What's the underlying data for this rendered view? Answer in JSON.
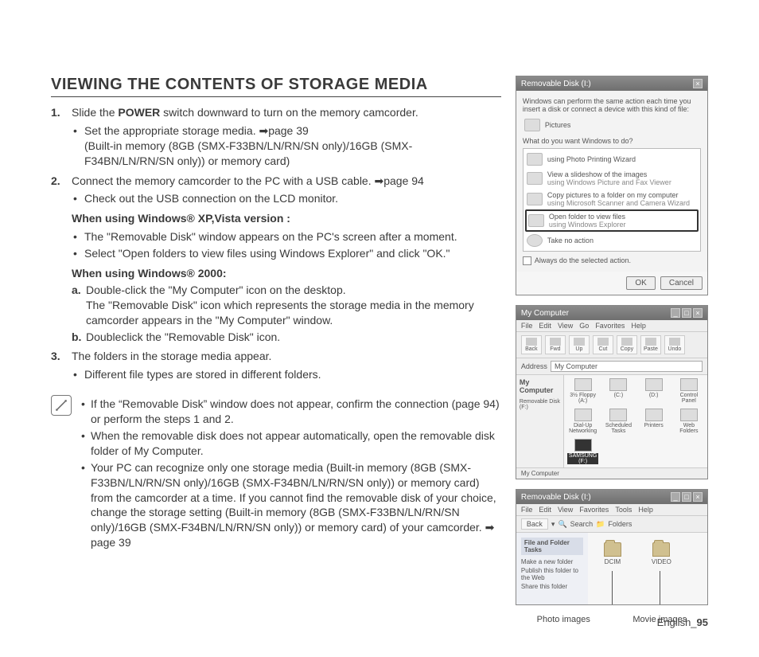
{
  "title": "VIEWING THE CONTENTS OF STORAGE MEDIA",
  "step1": {
    "text_a": "Slide the ",
    "bold": "POWER",
    "text_b": " switch downward to turn on the memory camcorder.",
    "b1": "Set the appropriate storage media. ",
    "b1_ref": "page 39",
    "b1_detail": "(Built-in memory (8GB (SMX-F33BN/LN/RN/SN only)/16GB (SMX-F34BN/LN/RN/SN only)) or memory card)"
  },
  "step2": {
    "text": "Connect the memory camcorder to the PC with a USB cable. ",
    "ref": "page 94",
    "b1": "Check out the USB connection on the LCD monitor.",
    "xp_head": "When using Windows® XP,Vista version :",
    "xp_b1": "The \"Removable Disk\" window appears on the PC's screen after a moment.",
    "xp_b2": "Select \"Open folders to view files using Windows Explorer\" and click \"OK.\"",
    "w2k_head": "When using Windows® 2000:",
    "a_text": "Double-click the \"My Computer\" icon on the desktop.\nThe \"Removable Disk\" icon which represents the storage media in the memory camcorder appears in the \"My Computer\" window.",
    "b_text": "Doubleclick the \"Removable Disk\" icon."
  },
  "step3": {
    "text": "The folders in the storage media appear.",
    "b1": "Different file types are stored in different folders."
  },
  "note": {
    "b1": "If the “Removable Disk” window does not appear, confirm the connection (page 94) or perform the steps 1 and 2.",
    "b2": "When the removable disk does not appear automatically, open the removable disk folder of My Computer.",
    "b3": "Your PC can recognize only one storage media (Built-in memory (8GB (SMX-F33BN/LN/RN/SN only)/16GB (SMX-F34BN/LN/RN/SN only)) or memory card) from the camcorder at a time. If you cannot find the removable disk of your choice, change the storage setting (Built-in memory (8GB (SMX-F33BN/LN/RN/SN only)/16GB (SMX-F34BN/LN/RN/SN only)) or memory card) of your camcorder. ",
    "b3_ref": "page 39"
  },
  "dialog1": {
    "title": "Removable Disk (I:)",
    "intro": "Windows can perform the same action each time you insert a disk or connect a device with this kind of file:",
    "type": "Pictures",
    "prompt": "What do you want Windows to do?",
    "opt1": "using Photo Printing Wizard",
    "opt2a": "View a slideshow of the images",
    "opt2b": "using Windows Picture and Fax Viewer",
    "opt3a": "Copy pictures to a folder on my computer",
    "opt3b": "using Microsoft Scanner and Camera Wizard",
    "opt4a": "Open folder to view files",
    "opt4b": "using Windows Explorer",
    "opt5": "Take no action",
    "always": "Always do the selected action.",
    "ok": "OK",
    "cancel": "Cancel"
  },
  "dialog2": {
    "title": "My Computer",
    "menu": [
      "File",
      "Edit",
      "View",
      "Go",
      "Favorites",
      "Help"
    ],
    "tools": [
      "Back",
      "Fwd",
      "Up",
      "Cut",
      "Copy",
      "Paste",
      "Undo"
    ],
    "addr_label": "Address",
    "addr_value": "My Computer",
    "left_title": "My Computer",
    "left_sub": "Removable Disk (F:)",
    "drives": [
      "3½ Floppy (A:)",
      "(C:)",
      "(D:)",
      "Control Panel",
      "Dial-Up Networking",
      "Scheduled Tasks",
      "Printers",
      "Web Folders",
      "SAMSUNG (F:)"
    ],
    "status": "My Computer"
  },
  "dialog3": {
    "title": "Removable Disk (I:)",
    "menu": [
      "File",
      "Edit",
      "View",
      "Favorites",
      "Tools",
      "Help"
    ],
    "toolbar": [
      "Back",
      "Search",
      "Folders"
    ],
    "task_title": "File and Folder Tasks",
    "tasks": [
      "Make a new folder",
      "Publish this folder to the Web",
      "Share this folder"
    ],
    "folder1": "DCIM",
    "folder2": "VIDEO"
  },
  "captions": {
    "photo": "Photo images",
    "movie": "Movie images"
  },
  "footer": {
    "lang": "English",
    "sep": "_",
    "page": "95"
  }
}
